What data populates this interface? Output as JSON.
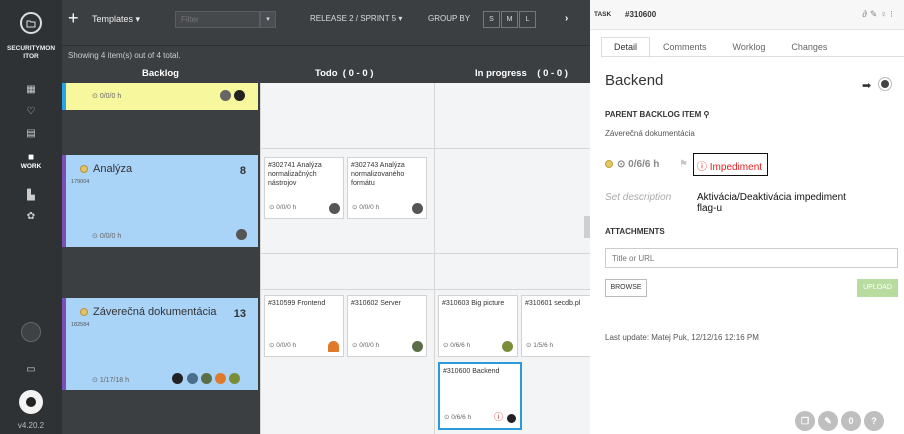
{
  "sidebar": {
    "app_name": "SECURITYMON ITOR",
    "work_label": "WORK",
    "version": "v4.20.2"
  },
  "toolbar": {
    "plus": "+",
    "templates": "Templates ▾",
    "filter_placeholder": "Filter",
    "release": "RELEASE 2 / SPRINT 5 ▾",
    "group_by": "GROUP BY",
    "sizes": [
      "S",
      "M",
      "L"
    ],
    "next": "›"
  },
  "board": {
    "showing": "Showing 4 item(s) out of 4 total.",
    "columns": {
      "backlog": "Backlog",
      "todo": "Todo  ( 0 - 0 )",
      "inprog": "In progress    ( 0 - 0 )"
    },
    "lanes": [
      {
        "time": "0/0/0 h"
      },
      {
        "title": "Analýza",
        "id": "179004",
        "count": "8",
        "time": "0/0/0 h"
      },
      {
        "title": "Záverečná dokumentácia",
        "id": "182584",
        "count": "13",
        "time": "1/17/18 h"
      }
    ],
    "tasks": {
      "t1": {
        "title": "#302741 Analýza normalizačných nástrojov",
        "time": "0/0/0 h"
      },
      "t2": {
        "title": "#302743 Analýza normalizovaného formátu",
        "time": "0/0/0 h"
      },
      "t3": {
        "title": "#310599 Frontend",
        "time": "0/0/0 h"
      },
      "t4": {
        "title": "#310602 Server",
        "time": "0/0/0 h"
      },
      "t5": {
        "title": "#310603 Big picture",
        "time": "0/6/6 h"
      },
      "t6": {
        "title": "#310601 secdb.pl",
        "time": "1/5/6 h"
      },
      "t7": {
        "title": "#310600 Backend",
        "time": "0/6/6 h"
      }
    }
  },
  "panel": {
    "task_label": "TASK",
    "task_id": "#310600",
    "tabs": [
      "Detail",
      "Comments",
      "Worklog",
      "Changes"
    ],
    "title": "Backend",
    "parent_head": "PARENT BACKLOG ITEM",
    "parent_value": "Záverečná dokumentácia",
    "time": "0/6/6 h",
    "impediment": "Impediment",
    "set_description": "Set description",
    "annotation": "Aktivácia/Deaktivácia impediment flag-u",
    "attachments_head": "ATTACHMENTS",
    "url_placeholder": "Title or URL",
    "browse": "BROWSE",
    "upload": "UPLOAD",
    "last_update": "Last update: Matej Puk, 12/12/16 12:16 PM",
    "fab_zero": "0",
    "fab_question": "?"
  },
  "colors": {
    "accent_blue": "#2b9bd8",
    "lane_blue": "#a9d3f7",
    "lane_yellow": "#f7f79e",
    "impediment_red": "#e02020",
    "upload_green": "#b8dba0"
  }
}
